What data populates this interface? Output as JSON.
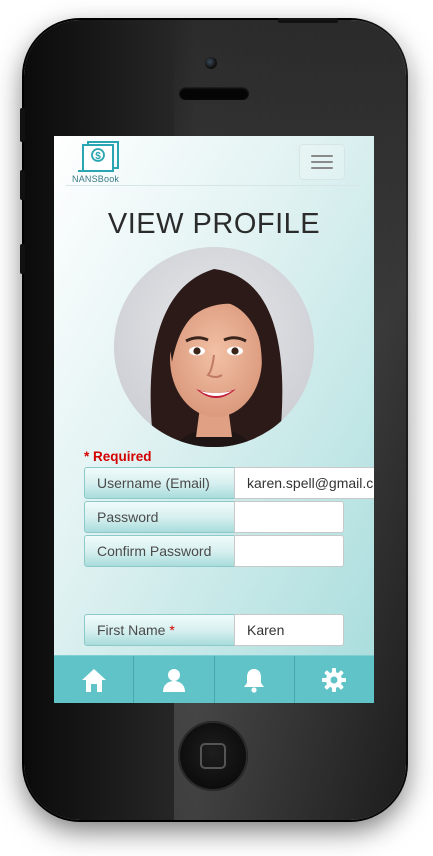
{
  "app": {
    "logo_text": "NANSBook"
  },
  "page": {
    "title": "VIEW PROFILE"
  },
  "form": {
    "required_marker": "*",
    "required_label": "Required",
    "fields": [
      {
        "label": "Username (Email)",
        "value": "karen.spell@gmail.c"
      },
      {
        "label": "Password",
        "value": ""
      },
      {
        "label": "Confirm Password",
        "value": ""
      },
      {
        "label": "First Name",
        "required_star": "*",
        "value": "Karen"
      }
    ]
  },
  "tabs": [
    {
      "icon": "home-icon"
    },
    {
      "icon": "user-icon"
    },
    {
      "icon": "bell-icon"
    },
    {
      "icon": "gear-icon"
    }
  ],
  "colors": {
    "accent": "#5fc3c7",
    "required": "#d40000",
    "title": "#2b2b2b"
  }
}
